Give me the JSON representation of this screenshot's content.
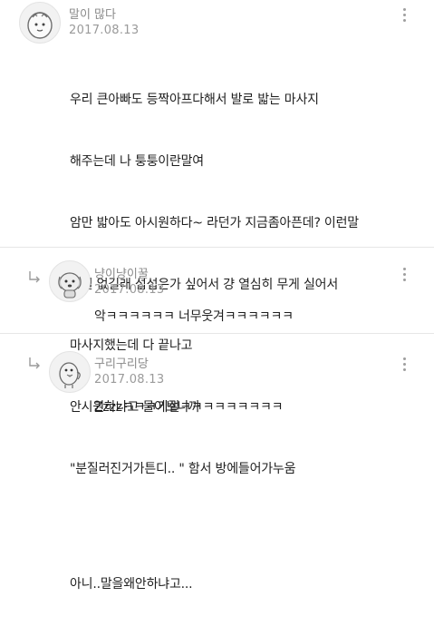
{
  "comments": [
    {
      "author": "말이 많다",
      "date": "2017.08.13",
      "avatar_icon": "egg-character-icon",
      "lines": [
        "우리 큰아빠도 등짝아프다해서 발로 밟는 마사지",
        "해주는데 나 퉁퉁이란말여",
        "암만 밟아도 아시원하다~ 라던가 지금좀아픈데? 이런말",
        "일절 없길래 섭섭은가 싶어서 걍 열심히 무게 실어서",
        "마사지했는데 다 끝나고",
        "안시원하냐고 물어보니까",
        "\"분질러진거가튼디.. \" 함서 방에들어가누움",
        "",
        "아니..말을왜안하냐고..."
      ]
    },
    {
      "author": "냥이냥이꿀",
      "date": "2017.08.13",
      "avatar_icon": "dog-character-icon",
      "text": "악ㅋㅋㅋㅋㅋㅋ 너무웃겨ㅋㅋㅋㅋㅋㅋ"
    },
    {
      "author": "구리구리당",
      "date": "2017.08.13",
      "avatar_icon": "bird-character-icon",
      "text": "Zzzzㅋㅋㅋ기절ㅋㅋㅋㅋㅋㅋㅋㅋㅋ"
    }
  ],
  "icons": {
    "more": "more-vertical-icon",
    "reply": "reply-arrow-icon"
  },
  "colors": {
    "meta_text": "#8a8a8a",
    "body_text": "#1e1e1e",
    "divider": "#e6e6e6"
  }
}
